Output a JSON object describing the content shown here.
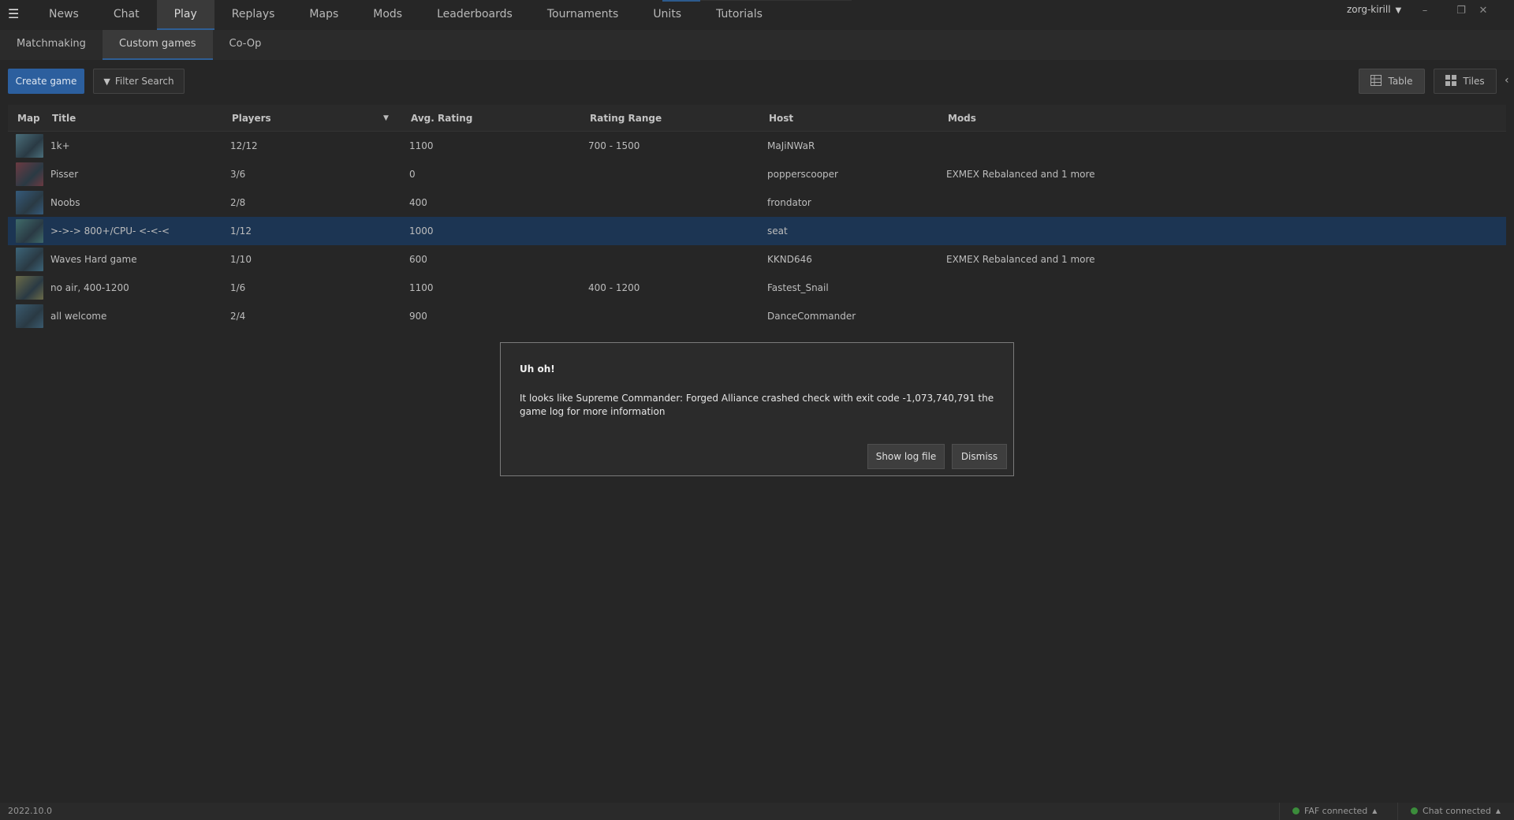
{
  "nav": {
    "menu_icon": "hamburger-icon",
    "tabs": [
      {
        "label": "News"
      },
      {
        "label": "Chat"
      },
      {
        "label": "Play",
        "active": true
      },
      {
        "label": "Replays"
      },
      {
        "label": "Maps"
      },
      {
        "label": "Mods"
      },
      {
        "label": "Leaderboards"
      },
      {
        "label": "Tournaments"
      },
      {
        "label": "Units"
      },
      {
        "label": "Tutorials"
      }
    ],
    "user": "zorg-kirill",
    "window_controls": {
      "minimize": "–",
      "restore": "❐",
      "close": "✕"
    }
  },
  "subnav": {
    "tabs": [
      {
        "label": "Matchmaking"
      },
      {
        "label": "Custom games",
        "active": true
      },
      {
        "label": "Co-Op"
      }
    ]
  },
  "toolbar": {
    "create_game": "Create game",
    "filter_search": "Filter Search",
    "view_table": "Table",
    "view_tiles": "Tiles"
  },
  "table": {
    "headers": {
      "map": "Map",
      "title": "Title",
      "players": "Players",
      "avg_rating": "Avg. Rating",
      "rating_range": "Rating Range",
      "host": "Host",
      "mods": "Mods"
    },
    "rows": [
      {
        "title": "1k+",
        "players": "12/12",
        "avg_rating": "1100",
        "rating_range": "700 - 1500",
        "host": "MaJiNWaR",
        "mods": "",
        "thumb_color": "#4a6e7a"
      },
      {
        "title": "Pisser",
        "players": "3/6",
        "avg_rating": "0",
        "rating_range": "",
        "host": "popperscooper",
        "mods": "EXMEX Rebalanced and 1 more",
        "thumb_color": "#6b3a42"
      },
      {
        "title": "Noobs",
        "players": "2/8",
        "avg_rating": "400",
        "rating_range": "",
        "host": "frondator",
        "mods": "",
        "thumb_color": "#355a7a"
      },
      {
        "title": ">->-> 800+/CPU- <-<-<",
        "players": "1/12",
        "avg_rating": "1000",
        "rating_range": "",
        "host": "seat",
        "mods": "",
        "thumb_color": "#3f6a6a",
        "selected": true
      },
      {
        "title": "Waves Hard game",
        "players": "1/10",
        "avg_rating": "600",
        "rating_range": "",
        "host": "KKND646",
        "mods": "EXMEX Rebalanced and 1 more",
        "thumb_color": "#3c6478"
      },
      {
        "title": "no air, 400-1200",
        "players": "1/6",
        "avg_rating": "1100",
        "rating_range": "400 - 1200",
        "host": "Fastest_Snail",
        "mods": "",
        "thumb_color": "#6a6a48"
      },
      {
        "title": "all welcome",
        "players": "2/4",
        "avg_rating": "900",
        "rating_range": "",
        "host": "DanceCommander",
        "mods": "",
        "thumb_color": "#3a5a6e"
      }
    ]
  },
  "dialog": {
    "title": "Uh oh!",
    "message": "It looks like Supreme Commander: Forged Alliance crashed check with exit code -1,073,740,791 the game log  for more information",
    "show_log": "Show log file",
    "dismiss": "Dismiss"
  },
  "status": {
    "version": "2022.10.0",
    "faf": "FAF connected",
    "chat": "Chat connected",
    "connected_color": "#3b8c3b"
  },
  "colors": {
    "accent": "#2c5f9e",
    "selected_row": "#1c3553",
    "background": "#262626"
  }
}
